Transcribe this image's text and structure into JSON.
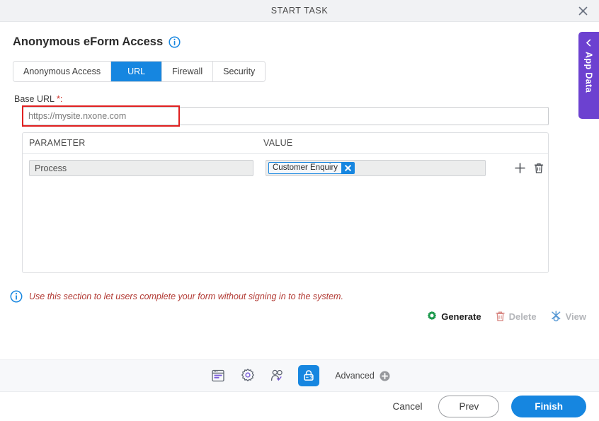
{
  "window": {
    "title": "START TASK",
    "close_icon": "close-icon"
  },
  "section": {
    "heading": "Anonymous eForm Access",
    "info_icon": "info-circle-icon"
  },
  "tabs": [
    {
      "label": "Anonymous Access",
      "active": false
    },
    {
      "label": "URL",
      "active": true
    },
    {
      "label": "Firewall",
      "active": false
    },
    {
      "label": "Security",
      "active": false
    }
  ],
  "base_url": {
    "label": "Base URL",
    "required_marker": "*:",
    "value": "https://mysite.nxone.com",
    "placeholder": "https://mysite.nxone.com",
    "highlight_color": "#e02020"
  },
  "param_table": {
    "columns": [
      "PARAMETER",
      "VALUE"
    ],
    "rows": [
      {
        "parameter": "Process",
        "value_chip": "Customer Enquiry",
        "chip_remove_icon": "close-icon",
        "add_icon": "plus-icon",
        "delete_icon": "trash-icon"
      }
    ]
  },
  "note": {
    "icon": "info-circle-icon",
    "text": "Use this section to let users complete your form without signing in to the system."
  },
  "actions": [
    {
      "label": "Generate",
      "icon": "gear-icon",
      "enabled": true,
      "icon_color": "#1d9a4e"
    },
    {
      "label": "Delete",
      "icon": "trash-icon",
      "enabled": false,
      "icon_color": "#d98b86"
    },
    {
      "label": "View",
      "icon": "view-icon",
      "enabled": false,
      "icon_color": "#5b9bd5"
    }
  ],
  "toolbar": {
    "icons": [
      {
        "name": "form-icon",
        "active": false
      },
      {
        "name": "gear-icon",
        "active": false
      },
      {
        "name": "user-check-icon",
        "active": false
      },
      {
        "name": "lock-question-icon",
        "active": true
      }
    ],
    "advanced_label": "Advanced",
    "advanced_icon": "plus-circle-icon"
  },
  "footer": {
    "cancel_label": "Cancel",
    "prev_label": "Prev",
    "finish_label": "Finish"
  },
  "app_data_tab": {
    "label": "App Data",
    "chevron_icon": "chevron-left-icon",
    "color": "#6c41d0"
  },
  "colors": {
    "accent_blue": "#1686e0",
    "purple": "#6c41d0",
    "note_red": "#b23a34",
    "green": "#1d9a4e"
  }
}
